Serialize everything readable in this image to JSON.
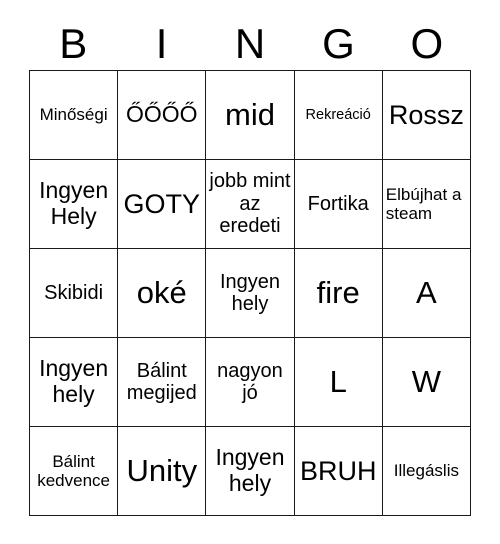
{
  "card": {
    "title_letters": [
      "B",
      "I",
      "N",
      "G",
      "O"
    ],
    "columns": 5,
    "rows": 5,
    "colors": {
      "background": "#ffffff",
      "border": "#1a1a1a",
      "text": "#000000"
    },
    "cells": [
      [
        {
          "text": "Minőségi",
          "size": "sm",
          "align": "center"
        },
        {
          "text": "ŐŐŐŐ",
          "size": "lg",
          "align": "center"
        },
        {
          "text": "mid",
          "size": "xxl",
          "align": "center"
        },
        {
          "text": "Rekreáció",
          "size": "xs",
          "align": "center"
        },
        {
          "text": "Rossz",
          "size": "xl",
          "align": "center"
        }
      ],
      [
        {
          "text": "Ingyen Hely",
          "size": "lg",
          "align": "center"
        },
        {
          "text": "GOTY",
          "size": "xl",
          "align": "center"
        },
        {
          "text": "jobb mint az eredeti",
          "size": "md",
          "align": "center"
        },
        {
          "text": "Fortika",
          "size": "md",
          "align": "center"
        },
        {
          "text": "Elbújhat a steam",
          "size": "sm",
          "align": "left"
        }
      ],
      [
        {
          "text": "Skibidi",
          "size": "md",
          "align": "center"
        },
        {
          "text": "oké",
          "size": "xxl",
          "align": "center"
        },
        {
          "text": "Ingyen hely",
          "size": "md",
          "align": "center"
        },
        {
          "text": "fire",
          "size": "xxl",
          "align": "center"
        },
        {
          "text": "A",
          "size": "xxl",
          "align": "center"
        }
      ],
      [
        {
          "text": "Ingyen hely",
          "size": "lg",
          "align": "center"
        },
        {
          "text": "Bálint megijed",
          "size": "md",
          "align": "center"
        },
        {
          "text": "nagyon jó",
          "size": "md",
          "align": "center"
        },
        {
          "text": "L",
          "size": "xxl",
          "align": "center"
        },
        {
          "text": "W",
          "size": "xxl",
          "align": "center"
        }
      ],
      [
        {
          "text": "Bálint kedvence",
          "size": "sm",
          "align": "center"
        },
        {
          "text": "Unity",
          "size": "xxl",
          "align": "center"
        },
        {
          "text": "Ingyen hely",
          "size": "lg",
          "align": "center"
        },
        {
          "text": "BRUH",
          "size": "xl",
          "align": "center"
        },
        {
          "text": "Illegáslis",
          "size": "sm",
          "align": "center"
        }
      ]
    ]
  }
}
